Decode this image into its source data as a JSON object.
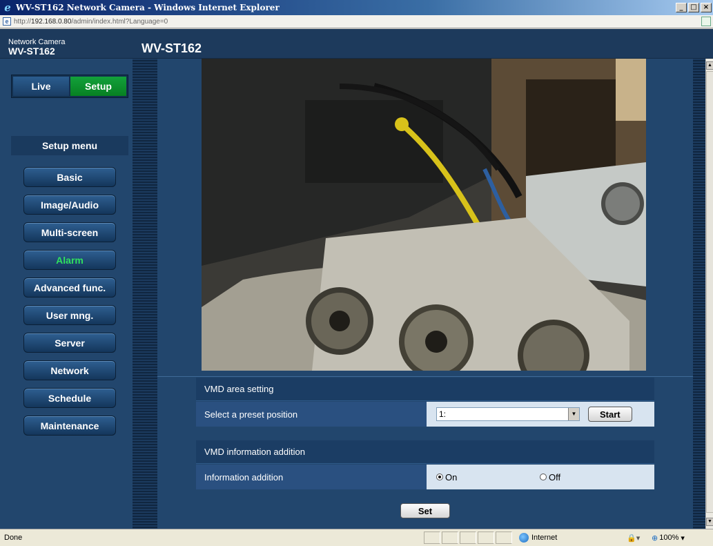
{
  "window": {
    "title": "WV-ST162 Network Camera - Windows Internet Explorer",
    "minimize_glyph": "_",
    "maximize_glyph": "□",
    "close_glyph": "×"
  },
  "address_bar": {
    "url_prefix": "http://",
    "url_host": "192.168.0.80",
    "url_path": "/admin/index.html?Language=0"
  },
  "header": {
    "brand_sub": "Network Camera",
    "brand_model": "WV-ST162",
    "model_title": "WV-ST162"
  },
  "mode_tabs": {
    "live": "Live",
    "setup": "Setup"
  },
  "sidebar": {
    "title": "Setup menu",
    "items": [
      {
        "label": "Basic",
        "active": false
      },
      {
        "label": "Image/Audio",
        "active": false
      },
      {
        "label": "Multi-screen",
        "active": false
      },
      {
        "label": "Alarm",
        "active": true
      },
      {
        "label": "Advanced func.",
        "active": false
      },
      {
        "label": "User mng.",
        "active": false
      },
      {
        "label": "Server",
        "active": false
      },
      {
        "label": "Network",
        "active": false
      },
      {
        "label": "Schedule",
        "active": false
      },
      {
        "label": "Maintenance",
        "active": false
      }
    ]
  },
  "vmd_area": {
    "section_title": "VMD area setting",
    "preset_label": "Select a preset position",
    "preset_value": "1:",
    "start_button": "Start"
  },
  "vmd_info": {
    "section_title": "VMD information addition",
    "info_label": "Information addition",
    "option_on": "On",
    "option_off": "Off",
    "selected": "On"
  },
  "set_button": "Set",
  "status_bar": {
    "status": "Done",
    "zone": "Internet",
    "zoom": "100%"
  },
  "colors": {
    "page_bg": "#1d3a5c",
    "setup_tab": "#13a13b",
    "active_menu_text": "#2fe05e"
  },
  "icons": [
    "ie-icon",
    "page-icon",
    "compat-view-icon",
    "globe-icon",
    "lock-icon",
    "zoom-icon",
    "dropdown-arrow-icon"
  ]
}
